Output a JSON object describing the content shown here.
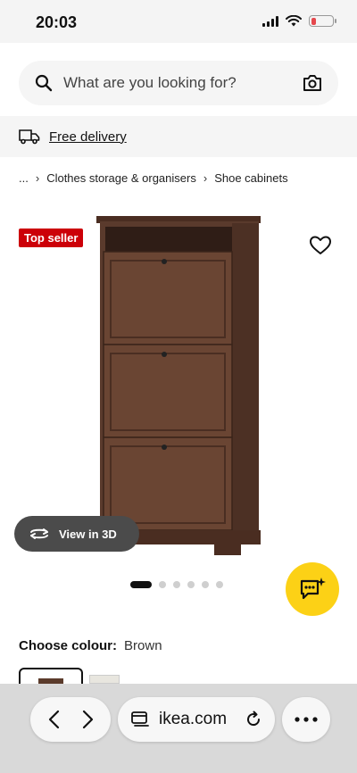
{
  "status_bar": {
    "time": "20:03"
  },
  "search": {
    "placeholder": "What are you looking for?"
  },
  "delivery": {
    "label": "Free delivery"
  },
  "breadcrumb": {
    "ellipsis": "...",
    "items": [
      "Clothes storage & organisers",
      "Shoe cabinets"
    ]
  },
  "product": {
    "badge": "Top seller",
    "view_3d_label": "View in 3D",
    "image_slides": 6,
    "active_slide": 1
  },
  "colour": {
    "label": "Choose colour:",
    "value": "Brown"
  },
  "browser": {
    "url": "ikea.com"
  },
  "colors": {
    "badge_red": "#cc0008",
    "chat_yellow": "#fcd116",
    "battery_red": "#e5484d"
  }
}
